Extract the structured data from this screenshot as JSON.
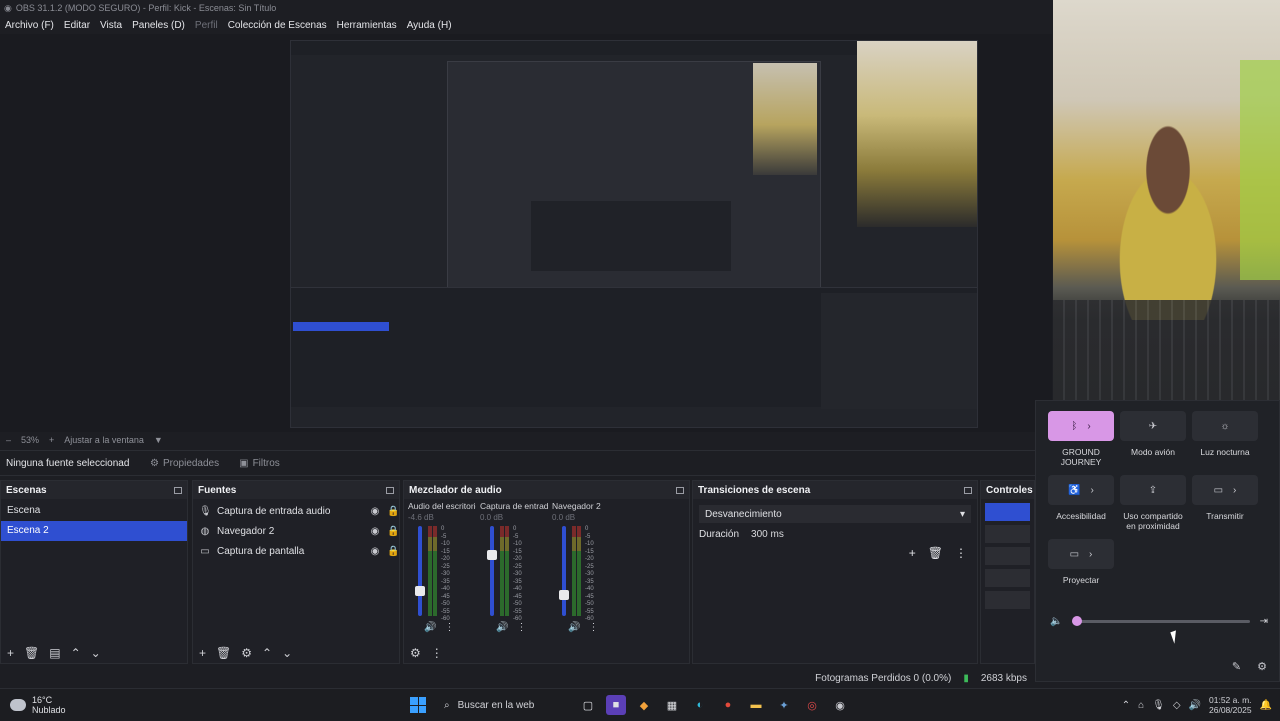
{
  "window": {
    "title": "OBS 31.1.2 (MODO SEGURO) - Perfil: Kick - Escenas: Sin Título"
  },
  "menu": [
    {
      "label": "Archivo (F)",
      "dim": false
    },
    {
      "label": "Editar",
      "dim": false
    },
    {
      "label": "Vista",
      "dim": false
    },
    {
      "label": "Paneles (D)",
      "dim": false
    },
    {
      "label": "Perfil",
      "dim": true
    },
    {
      "label": "Colección de Escenas",
      "dim": false
    },
    {
      "label": "Herramientas",
      "dim": false
    },
    {
      "label": "Ayuda (H)",
      "dim": false
    }
  ],
  "zoom": {
    "percent": "53%",
    "fit_label": "Ajustar a la ventana"
  },
  "props_bar": {
    "no_source": "Ninguna fuente seleccionad",
    "properties": "Propiedades",
    "filters": "Filtros"
  },
  "scenes": {
    "title": "Escenas",
    "items": [
      "Escena",
      "Escena 2"
    ],
    "active_index": 1
  },
  "sources": {
    "title": "Fuentes",
    "items": [
      {
        "name": "Captura de entrada audio",
        "icon": "microphone-icon"
      },
      {
        "name": "Navegador 2",
        "icon": "globe-icon"
      },
      {
        "name": "Captura de pantalla",
        "icon": "monitor-icon"
      }
    ]
  },
  "mixer": {
    "title": "Mezclador de audio",
    "channels": [
      {
        "name": "Audio del escritorio",
        "db": "-4.6 dB",
        "level": 0.25
      },
      {
        "name": "Captura de entrada",
        "db": "0.0 dB",
        "level": 0.7
      },
      {
        "name": "Navegador 2",
        "db": "0.0 dB",
        "level": 0.2
      }
    ],
    "scale": [
      "0",
      "-5",
      "-10",
      "-15",
      "-20",
      "-25",
      "-30",
      "-35",
      "-40",
      "-45",
      "-50",
      "-55",
      "-60"
    ]
  },
  "transitions": {
    "title": "Transiciones de escena",
    "selected": "Desvanecimiento",
    "duration_label": "Duración",
    "duration_value": "300 ms"
  },
  "controls": {
    "title": "Controles"
  },
  "status": {
    "dropped": "Fotogramas Perdidos 0 (0.0%)",
    "bitrate": "2683 kbps"
  },
  "quick_settings": {
    "tiles": [
      {
        "label": "GROUND JOURNEY",
        "icon": "bluetooth-icon",
        "on": true,
        "chevron": true
      },
      {
        "label": "Modo avión",
        "icon": "airplane-icon",
        "on": false,
        "chevron": false
      },
      {
        "label": "Luz nocturna",
        "icon": "sun-icon",
        "on": false,
        "chevron": false
      },
      {
        "label": "Accesibilidad",
        "icon": "accessibility-icon",
        "on": false,
        "chevron": true
      },
      {
        "label": "Uso compartido en proximidad",
        "icon": "share-icon",
        "on": false,
        "chevron": false
      },
      {
        "label": "Transmitir",
        "icon": "cast-icon",
        "on": false,
        "chevron": true
      },
      {
        "label": "Proyectar",
        "icon": "project-icon",
        "on": false,
        "chevron": true
      }
    ],
    "volume_level": 0.0
  },
  "taskbar": {
    "weather_temp": "16°C",
    "weather_desc": "Nublado",
    "search_placeholder": "Buscar en la web",
    "time": "01:52 a. m.",
    "date": "26/08/2025"
  },
  "colors": {
    "accent": "#2f4fd1",
    "qs_on": "#d897e6",
    "panel": "#1f2026"
  }
}
